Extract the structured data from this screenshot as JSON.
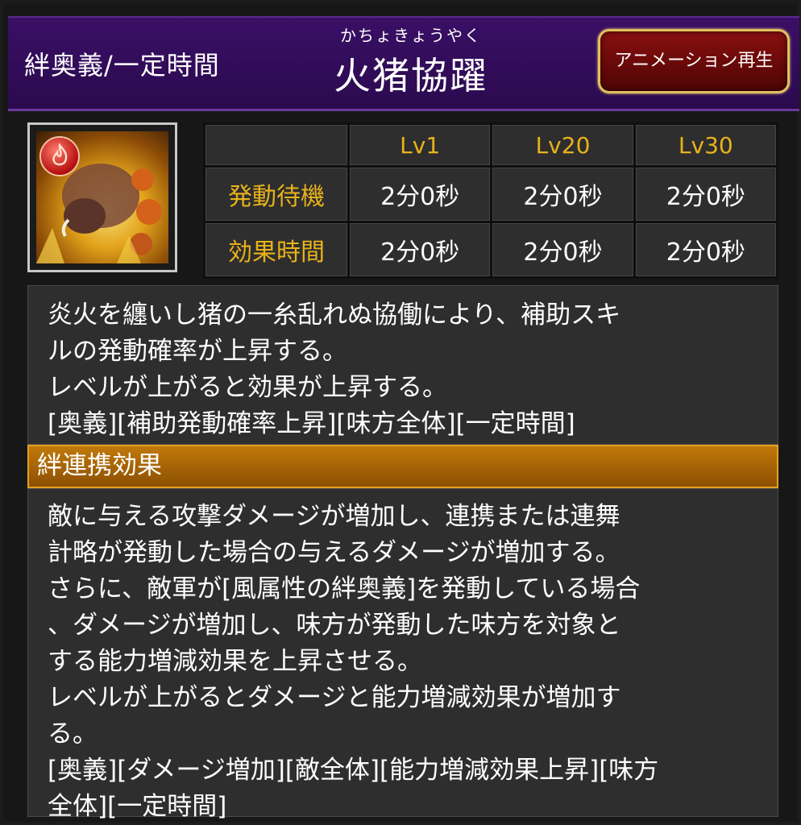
{
  "header": {
    "category": "絆奥義/一定時間",
    "ruby": "かちょきょうやく",
    "title": "火猪協躍",
    "animation_button": "アニメーション再生"
  },
  "skill_icon": {
    "element_badge_icon": "fire-icon",
    "art_icon": "boar-icon"
  },
  "stats": {
    "levels": [
      "Lv1",
      "Lv20",
      "Lv30"
    ],
    "rows": [
      {
        "label": "発動待機",
        "values": [
          "2分0秒",
          "2分0秒",
          "2分0秒"
        ]
      },
      {
        "label": "効果時間",
        "values": [
          "2分0秒",
          "2分0秒",
          "2分0秒"
        ]
      }
    ]
  },
  "description": {
    "lines": [
      "炎火を纏いし猪の一糸乱れぬ協働により、補助スキ",
      "ルの発動確率が上昇する。",
      "レベルが上がると効果が上昇する。",
      "[奥義][補助発動確率上昇][味方全体][一定時間]"
    ]
  },
  "bond_effect": {
    "heading": "絆連携効果",
    "lines": [
      "敵に与える攻撃ダメージが増加し、連携または連舞",
      "計略が発動した場合の与えるダメージが増加する。",
      "さらに、敵軍が[風属性の絆奥義]を発動している場合",
      "、ダメージが増加し、味方が発動した味方を対象と",
      "する能力増減効果を上昇させる。",
      "レベルが上がるとダメージと能力増減効果が増加す",
      "る。",
      "[奥義][ダメージ増加][敵全体][能力増減効果上昇][味方",
      "全体][一定時間]"
    ]
  },
  "colors": {
    "header_bg": "#2b0a4e",
    "accent_gold": "#e8b21a",
    "button_red": "#8a0f0f",
    "bar_orange": "#c07808"
  }
}
